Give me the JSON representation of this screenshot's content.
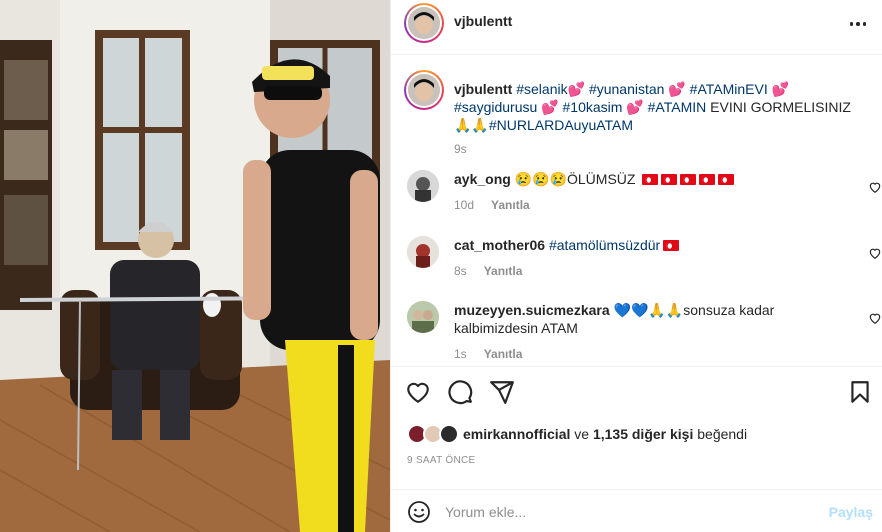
{
  "post": {
    "username": "vjbulentt",
    "more_icon": "more-horizontal-icon",
    "caption": {
      "username": "vjbulentt",
      "parts": [
        {
          "t": "#selanik",
          "tag": true
        },
        {
          "t": "💕 ",
          "tag": false
        },
        {
          "t": "#yunanistan",
          "tag": true
        },
        {
          "t": " 💕 ",
          "tag": false
        },
        {
          "t": "#ATAMinEVI",
          "tag": true
        },
        {
          "t": " 💕 ",
          "tag": false
        },
        {
          "t": "#saygidurusu",
          "tag": true
        },
        {
          "t": " 💕 ",
          "tag": false
        },
        {
          "t": "#10kasim",
          "tag": true
        },
        {
          "t": " 💕 ",
          "tag": false
        },
        {
          "t": "#ATAMIN",
          "tag": true
        },
        {
          "t": " EVINI GORMELISINIZ 🙏🙏",
          "tag": false
        },
        {
          "t": "#NURLARDAuyuATAM",
          "tag": true
        }
      ],
      "time": "9s"
    },
    "comments": [
      {
        "username": "ayk_ong",
        "text_before": " 😢😢😢ÖLÜMSÜZ ",
        "tag": "",
        "flags": 5,
        "time": "10d",
        "reply": "Yanıtla"
      },
      {
        "username": "cat_mother06",
        "text_before": " ",
        "tag": "#atamölümsüzdür",
        "flags": 1,
        "time": "8s",
        "reply": "Yanıtla"
      },
      {
        "username": "muzeyyen.suicmezkara",
        "text_before": " 💙💙🙏🙏sonsuza kadar kalbimizdesin ATAM",
        "tag": "",
        "flags": 0,
        "time": "1s",
        "reply": "Yanıtla"
      }
    ],
    "likes": {
      "user": "emirkannofficial",
      "connector": " ve ",
      "count_text": "1,135 diğer kişi",
      "suffix": " beğendi"
    },
    "posted_ago": "9 SAAT ÖNCE",
    "add_comment": {
      "placeholder": "Yorum ekle...",
      "post_label": "Paylaş"
    },
    "colors": {
      "hashtag": "#00376b",
      "secondary": "#8e8e8e",
      "post_button_disabled": "#b2dffc"
    },
    "icons": [
      "heart-icon",
      "comment-icon",
      "share-icon",
      "bookmark-icon",
      "emoji-icon"
    ]
  }
}
